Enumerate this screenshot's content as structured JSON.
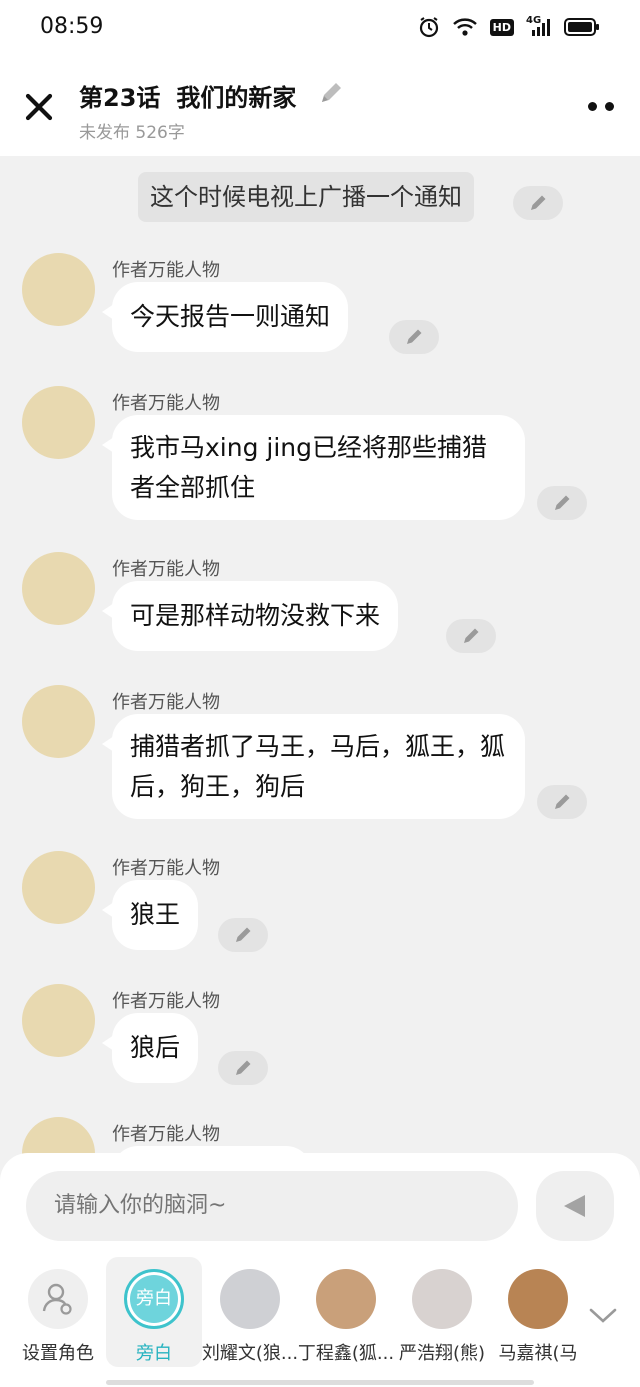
{
  "status_bar": {
    "time": "08:59",
    "icons": [
      "alarm-icon",
      "wifi-icon",
      "hd-icon",
      "4g-signal-icon",
      "battery-icon"
    ],
    "hd_label": "HD",
    "net_label": "4G"
  },
  "header": {
    "close_icon": "close-icon",
    "title_episode": "第23话",
    "title_name": "我们的新家",
    "subtitle": "未发布 526字"
  },
  "chat": {
    "narration": "这个时候电视上广播一个通知",
    "messages": [
      {
        "name": "作者万能人物",
        "text": "今天报告一则通知"
      },
      {
        "name": "作者万能人物",
        "text": "我市马xing jing已经将那些捕猎者全部抓住"
      },
      {
        "name": "作者万能人物",
        "text": "可是那样动物没救下来"
      },
      {
        "name": "作者万能人物",
        "text": "捕猎者抓了马王，马后，狐王，狐后，狗王，狗后"
      },
      {
        "name": "作者万能人物",
        "text": "狼王"
      },
      {
        "name": "作者万能人物",
        "text": "狼后"
      },
      {
        "name": "作者万能人物",
        "text": ""
      }
    ]
  },
  "composer": {
    "placeholder": "请输入你的脑洞~"
  },
  "roles": [
    {
      "label": "设置角色"
    },
    {
      "label": "旁白",
      "circle_text": "旁白",
      "active": true
    },
    {
      "label": "刘耀文(狼..."
    },
    {
      "label": "丁程鑫(狐..."
    },
    {
      "label": "严浩翔(熊)"
    },
    {
      "label": "马嘉祺(马"
    }
  ],
  "colors": {
    "accent": "#27b3c0",
    "background": "#f1f1f1",
    "bubble": "#ffffff"
  }
}
